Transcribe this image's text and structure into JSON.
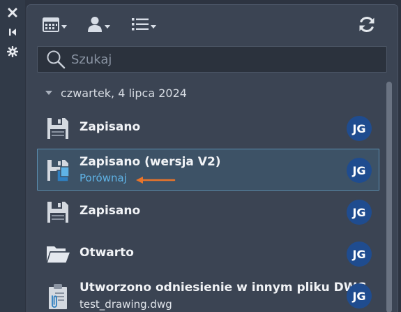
{
  "side_strip": {
    "icons": [
      "close-icon",
      "collapse-icon",
      "settings-icon"
    ]
  },
  "toolbar": {
    "buttons": [
      "calendar-view-icon",
      "user-filter-icon",
      "list-view-icon",
      "refresh-icon"
    ]
  },
  "search": {
    "placeholder": "Szukaj",
    "value": ""
  },
  "group": {
    "label": "czwartek, 4 lipca 2024"
  },
  "entries": [
    {
      "title": "Zapisano",
      "subtitle": "",
      "avatar": "JG",
      "icon": "save-icon"
    },
    {
      "title": "Zapisano (wersja V2)",
      "subtitle": "Porównaj",
      "avatar": "JG",
      "icon": "save-version-icon",
      "selected": true
    },
    {
      "title": "Zapisano",
      "subtitle": "",
      "avatar": "JG",
      "icon": "save-icon"
    },
    {
      "title": "Otwarto",
      "subtitle": "",
      "avatar": "JG",
      "icon": "open-folder-icon"
    },
    {
      "title": "Utworzono odniesienie w innym pliku DWG",
      "subtitle": "test_drawing.dwg",
      "avatar": "JG",
      "icon": "reference-icon"
    }
  ],
  "colors": {
    "accent_link": "#5fb3e6",
    "avatar_bg": "#1f4c8f",
    "annotation_arrow": "#e8742a",
    "selection_border": "#5b8fb0"
  }
}
